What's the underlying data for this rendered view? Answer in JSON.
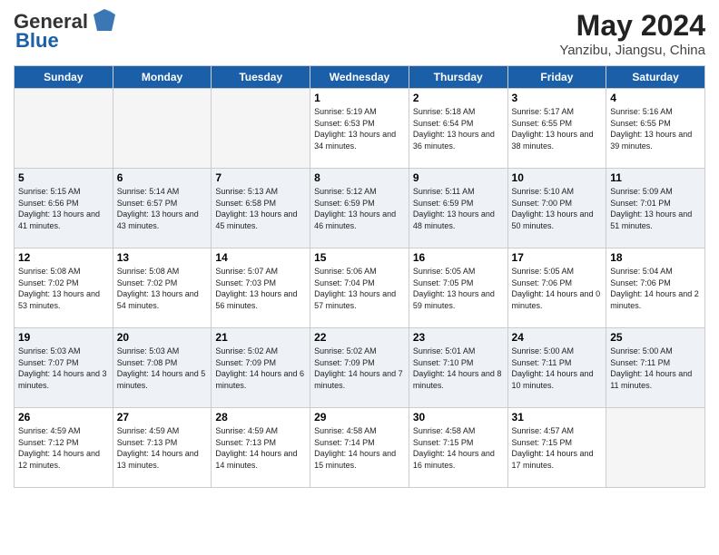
{
  "header": {
    "logo_general": "General",
    "logo_blue": "Blue",
    "month_year": "May 2024",
    "location": "Yanzibu, Jiangsu, China"
  },
  "days_of_week": [
    "Sunday",
    "Monday",
    "Tuesday",
    "Wednesday",
    "Thursday",
    "Friday",
    "Saturday"
  ],
  "weeks": [
    [
      {
        "day": "",
        "empty": true
      },
      {
        "day": "",
        "empty": true
      },
      {
        "day": "",
        "empty": true
      },
      {
        "day": "1",
        "sunrise": "5:19 AM",
        "sunset": "6:53 PM",
        "daylight": "13 hours and 34 minutes."
      },
      {
        "day": "2",
        "sunrise": "5:18 AM",
        "sunset": "6:54 PM",
        "daylight": "13 hours and 36 minutes."
      },
      {
        "day": "3",
        "sunrise": "5:17 AM",
        "sunset": "6:55 PM",
        "daylight": "13 hours and 38 minutes."
      },
      {
        "day": "4",
        "sunrise": "5:16 AM",
        "sunset": "6:55 PM",
        "daylight": "13 hours and 39 minutes."
      }
    ],
    [
      {
        "day": "5",
        "sunrise": "5:15 AM",
        "sunset": "6:56 PM",
        "daylight": "13 hours and 41 minutes."
      },
      {
        "day": "6",
        "sunrise": "5:14 AM",
        "sunset": "6:57 PM",
        "daylight": "13 hours and 43 minutes."
      },
      {
        "day": "7",
        "sunrise": "5:13 AM",
        "sunset": "6:58 PM",
        "daylight": "13 hours and 45 minutes."
      },
      {
        "day": "8",
        "sunrise": "5:12 AM",
        "sunset": "6:59 PM",
        "daylight": "13 hours and 46 minutes."
      },
      {
        "day": "9",
        "sunrise": "5:11 AM",
        "sunset": "6:59 PM",
        "daylight": "13 hours and 48 minutes."
      },
      {
        "day": "10",
        "sunrise": "5:10 AM",
        "sunset": "7:00 PM",
        "daylight": "13 hours and 50 minutes."
      },
      {
        "day": "11",
        "sunrise": "5:09 AM",
        "sunset": "7:01 PM",
        "daylight": "13 hours and 51 minutes."
      }
    ],
    [
      {
        "day": "12",
        "sunrise": "5:08 AM",
        "sunset": "7:02 PM",
        "daylight": "13 hours and 53 minutes."
      },
      {
        "day": "13",
        "sunrise": "5:08 AM",
        "sunset": "7:02 PM",
        "daylight": "13 hours and 54 minutes."
      },
      {
        "day": "14",
        "sunrise": "5:07 AM",
        "sunset": "7:03 PM",
        "daylight": "13 hours and 56 minutes."
      },
      {
        "day": "15",
        "sunrise": "5:06 AM",
        "sunset": "7:04 PM",
        "daylight": "13 hours and 57 minutes."
      },
      {
        "day": "16",
        "sunrise": "5:05 AM",
        "sunset": "7:05 PM",
        "daylight": "13 hours and 59 minutes."
      },
      {
        "day": "17",
        "sunrise": "5:05 AM",
        "sunset": "7:06 PM",
        "daylight": "14 hours and 0 minutes."
      },
      {
        "day": "18",
        "sunrise": "5:04 AM",
        "sunset": "7:06 PM",
        "daylight": "14 hours and 2 minutes."
      }
    ],
    [
      {
        "day": "19",
        "sunrise": "5:03 AM",
        "sunset": "7:07 PM",
        "daylight": "14 hours and 3 minutes."
      },
      {
        "day": "20",
        "sunrise": "5:03 AM",
        "sunset": "7:08 PM",
        "daylight": "14 hours and 5 minutes."
      },
      {
        "day": "21",
        "sunrise": "5:02 AM",
        "sunset": "7:09 PM",
        "daylight": "14 hours and 6 minutes."
      },
      {
        "day": "22",
        "sunrise": "5:02 AM",
        "sunset": "7:09 PM",
        "daylight": "14 hours and 7 minutes."
      },
      {
        "day": "23",
        "sunrise": "5:01 AM",
        "sunset": "7:10 PM",
        "daylight": "14 hours and 8 minutes."
      },
      {
        "day": "24",
        "sunrise": "5:00 AM",
        "sunset": "7:11 PM",
        "daylight": "14 hours and 10 minutes."
      },
      {
        "day": "25",
        "sunrise": "5:00 AM",
        "sunset": "7:11 PM",
        "daylight": "14 hours and 11 minutes."
      }
    ],
    [
      {
        "day": "26",
        "sunrise": "4:59 AM",
        "sunset": "7:12 PM",
        "daylight": "14 hours and 12 minutes."
      },
      {
        "day": "27",
        "sunrise": "4:59 AM",
        "sunset": "7:13 PM",
        "daylight": "14 hours and 13 minutes."
      },
      {
        "day": "28",
        "sunrise": "4:59 AM",
        "sunset": "7:13 PM",
        "daylight": "14 hours and 14 minutes."
      },
      {
        "day": "29",
        "sunrise": "4:58 AM",
        "sunset": "7:14 PM",
        "daylight": "14 hours and 15 minutes."
      },
      {
        "day": "30",
        "sunrise": "4:58 AM",
        "sunset": "7:15 PM",
        "daylight": "14 hours and 16 minutes."
      },
      {
        "day": "31",
        "sunrise": "4:57 AM",
        "sunset": "7:15 PM",
        "daylight": "14 hours and 17 minutes."
      },
      {
        "day": "",
        "empty": true
      }
    ]
  ]
}
